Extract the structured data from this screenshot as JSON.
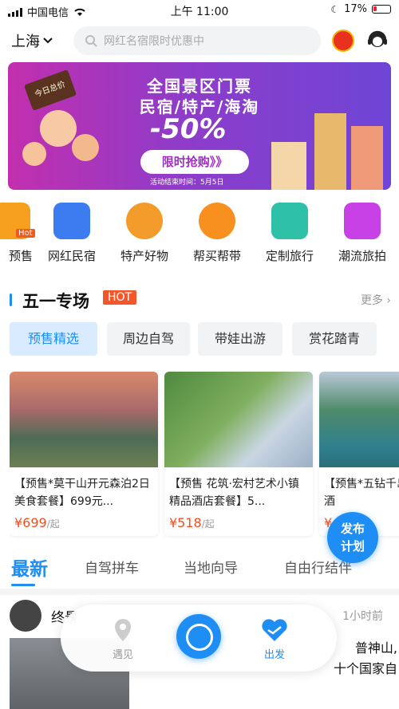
{
  "status_bar": {
    "carrier": "中国电信",
    "time": "上午 11:00",
    "battery": "17%"
  },
  "header": {
    "city": "上海",
    "search_placeholder": "网红名宿限时优惠中"
  },
  "banner": {
    "line1": "全国景区门票",
    "line2": "民宿/特产/海淘",
    "discount": "-50%",
    "cta": "限时抢购》》",
    "ends": "活动结束时间：5月5日",
    "sign": "今日总价"
  },
  "categories": [
    {
      "label": "预售",
      "badge": "Hot",
      "icon": "presale-icon"
    },
    {
      "label": "网红民宿",
      "icon": "house-icon"
    },
    {
      "label": "特产好物",
      "icon": "roast-chicken-icon"
    },
    {
      "label": "帮买帮带",
      "icon": "shopping-bag-icon"
    },
    {
      "label": "定制旅行",
      "icon": "book-icon"
    },
    {
      "label": "潮流旅拍",
      "icon": "camera-icon"
    }
  ],
  "section": {
    "title": "五一专场",
    "hot": "HOT",
    "more": "更多 ›"
  },
  "filter_tabs": [
    "预售精选",
    "周边自驾",
    "带娃出游",
    "赏花踏青"
  ],
  "cards": [
    {
      "title": "【预售*莫干山开元森泊2日美食套餐】699元...",
      "price": "¥699",
      "unit": "/起"
    },
    {
      "title": "【预售 花筑·宏村艺术小镇精品酒店套餐】5...",
      "price": "¥518",
      "unit": "/起"
    },
    {
      "title": "【预售*五钻千岛致雅艺术酒",
      "price": "¥",
      "unit": ""
    }
  ],
  "fab": {
    "line1": "发布",
    "line2": "计划"
  },
  "feed_tabs": [
    "最新",
    "自驾拼车",
    "当地向导",
    "自由行结伴"
  ],
  "post": {
    "user": "终景",
    "time": "1小时前",
    "text_line1": "普神山,",
    "text_line2": "十个国家自"
  },
  "bottom_nav": {
    "left": "遇见",
    "right": "出发"
  },
  "colors": {
    "accent": "#1e8ef5",
    "price": "#f24f23",
    "hot": "#f2572b"
  }
}
